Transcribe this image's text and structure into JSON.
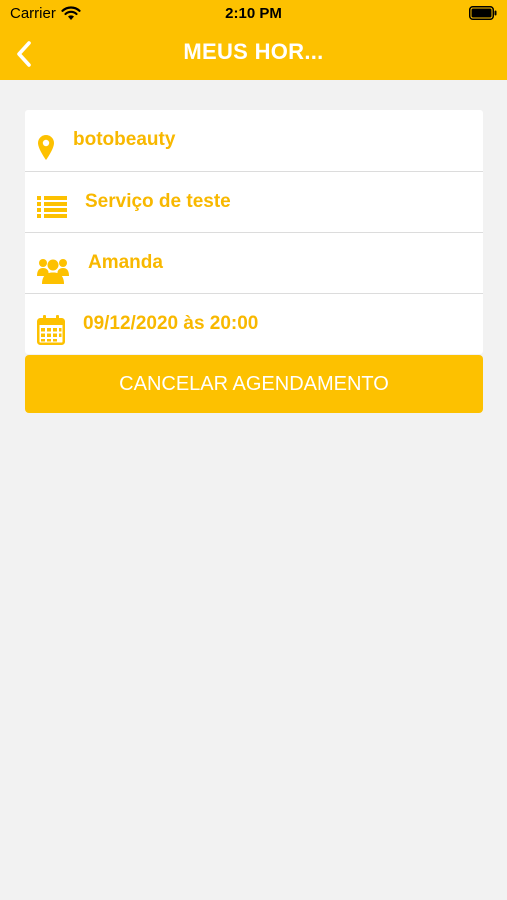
{
  "status_bar": {
    "carrier": "Carrier",
    "time": "2:10 PM"
  },
  "nav": {
    "title": "MEUS HOR..."
  },
  "details": {
    "salon": "botobeauty",
    "service": "Serviço de teste",
    "professional": "Amanda",
    "datetime": "09/12/2020 às 20:00"
  },
  "actions": {
    "cancel_label": "CANCELAR AGENDAMENTO"
  },
  "colors": {
    "accent": "#fdc100",
    "text_accent": "#f8b800",
    "background": "#f2f2f2"
  },
  "icons": {
    "salon": "map-pin-icon",
    "service": "list-icon",
    "professional": "users-icon",
    "datetime": "calendar-icon"
  }
}
